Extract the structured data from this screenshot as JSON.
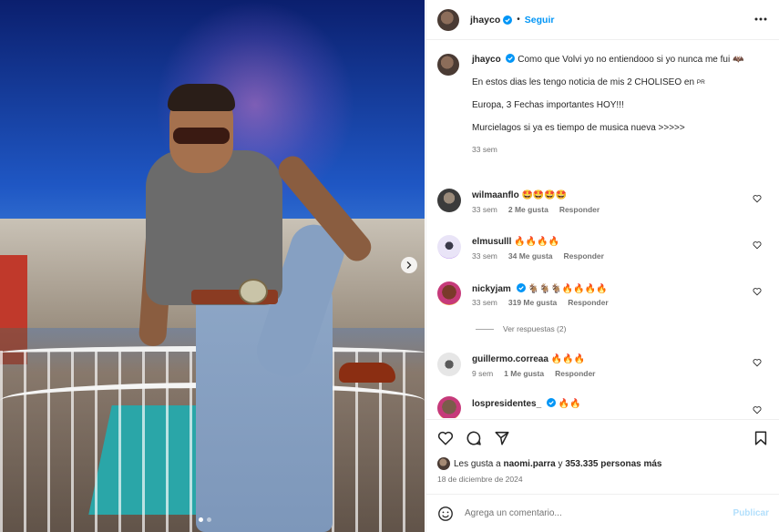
{
  "post": {
    "username": "jhayco",
    "follow_label": "Seguir",
    "separator": "•",
    "caption_lines": [
      "Como que Volvi yo no entiendooo si yo nunca me fui 🦇",
      "En estos dias les tengo noticia de mis 2 CHOLISEO en",
      "Europa, 3 Fechas importantes HOY!!!",
      "Murcielagos si ya es tiempo de musica nueva >>>>>"
    ],
    "caption_flag": "PR",
    "caption_age": "33 sem"
  },
  "comments": [
    {
      "username": "wilmaanflo",
      "text": "🤩🤩🤩🤩",
      "age": "33 sem",
      "likes": "2 Me gusta",
      "reply": "Responder",
      "avatar_color": "#3b3b3b"
    },
    {
      "username": "elmusulll",
      "text": "🔥🔥🔥🔥",
      "age": "33 sem",
      "likes": "34 Me gusta",
      "reply": "Responder",
      "avatar_color": "#e9e4f7"
    },
    {
      "username": "nickyjam",
      "text": "🐐🐐🐐🔥🔥🔥🔥",
      "age": "33 sem",
      "likes": "319 Me gusta",
      "reply": "Responder",
      "avatar_color": "#a83a2a"
    },
    {
      "username": "guillermo.correaa",
      "text": "🔥🔥🔥",
      "age": "9 sem",
      "likes": "1 Me gusta",
      "reply": "Responder",
      "avatar_color": "#d6d6d6"
    },
    {
      "username": "lospresidentes_",
      "text": "🔥🔥",
      "age": "",
      "likes": "",
      "reply": "",
      "avatar_color": "#7a5c4a"
    }
  ],
  "view_replies": "Ver respuestas (2)",
  "likes_line": {
    "prefix": "Les gusta a ",
    "user": "naomi.parra",
    "middle": " y ",
    "count": "353.335 personas más"
  },
  "date": "18 de diciembre de 2024",
  "comment_input": {
    "placeholder": "Agrega un comentario..."
  },
  "publish_label": "Publicar",
  "colors": {
    "accent": "#0095f6",
    "publish_disabled": "#b2dffc",
    "verified": "#0095f6"
  },
  "icons": [
    "heart-icon",
    "comment-icon",
    "share-icon",
    "bookmark-icon",
    "more-icon",
    "emoji-icon",
    "verified-badge-icon",
    "chevron-right-icon"
  ]
}
